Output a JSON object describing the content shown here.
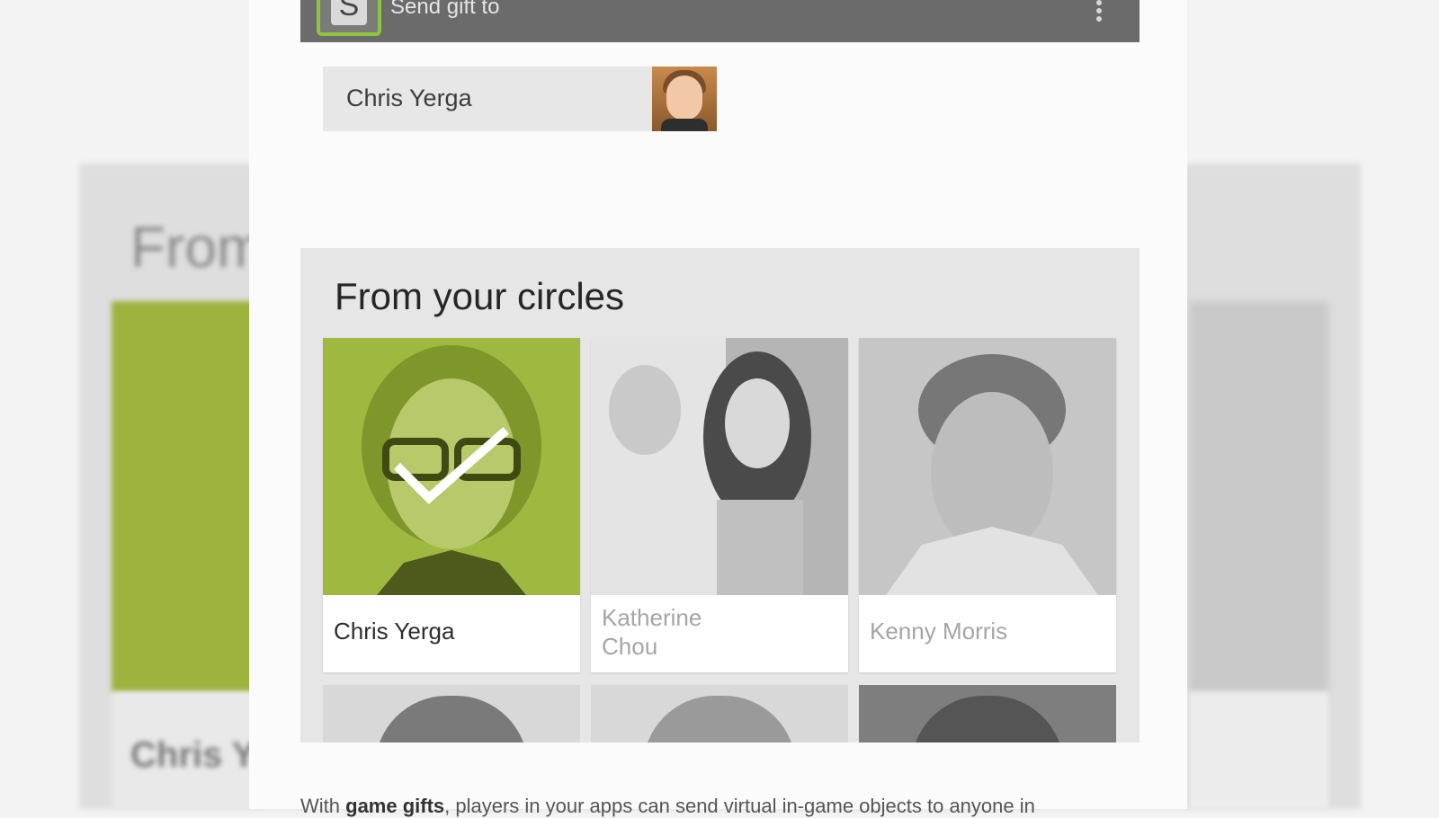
{
  "appbar": {
    "app_icon_letter": "S",
    "title": "Send gift to",
    "overflow_icon": "more-vert-icon"
  },
  "recipient": {
    "name": "Chris Yerga",
    "avatar": "avatar-photo"
  },
  "circles": {
    "title": "From your circles",
    "people": [
      {
        "name": "Chris Yerga",
        "selected": true
      },
      {
        "name_line1": "Katherine",
        "name_line2": "Chou",
        "selected": false
      },
      {
        "name": "Kenny Morris",
        "selected": false
      }
    ]
  },
  "background": {
    "blurred_title": "From",
    "blurred_name": "Chris Y"
  },
  "body_text": {
    "prefix": "With ",
    "bold": "game gifts",
    "suffix": ", players in your apps can send virtual in-game objects to anyone in"
  },
  "colors": {
    "appbar": "#6b6b6b",
    "selected_green": "#9fb83f",
    "app_icon_border": "#8fc43f"
  }
}
